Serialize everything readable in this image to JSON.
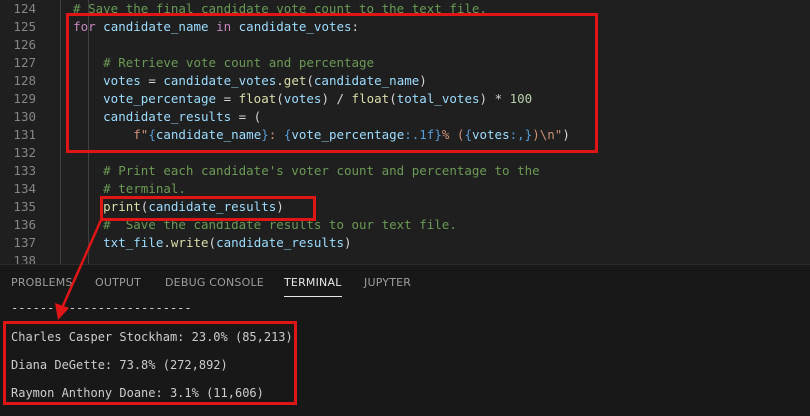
{
  "editor": {
    "lines": [
      {
        "n": "124",
        "segs": [
          {
            "t": "  # Save the final candidate vote count to the text file.",
            "c": "cm"
          }
        ]
      },
      {
        "n": "125",
        "segs": [
          {
            "t": "  ",
            "c": "op"
          },
          {
            "t": "for",
            "c": "kw"
          },
          {
            "t": " ",
            "c": "op"
          },
          {
            "t": "candidate_name",
            "c": "var"
          },
          {
            "t": " ",
            "c": "op"
          },
          {
            "t": "in",
            "c": "kw"
          },
          {
            "t": " ",
            "c": "op"
          },
          {
            "t": "candidate_votes",
            "c": "var"
          },
          {
            "t": ":",
            "c": "op"
          }
        ]
      },
      {
        "n": "126",
        "segs": [
          {
            "t": "",
            "c": "op"
          }
        ]
      },
      {
        "n": "127",
        "segs": [
          {
            "t": "      # Retrieve vote count and percentage",
            "c": "cm"
          }
        ]
      },
      {
        "n": "128",
        "segs": [
          {
            "t": "      ",
            "c": "op"
          },
          {
            "t": "votes",
            "c": "var"
          },
          {
            "t": " = ",
            "c": "op"
          },
          {
            "t": "candidate_votes",
            "c": "var"
          },
          {
            "t": ".",
            "c": "op"
          },
          {
            "t": "get",
            "c": "fn"
          },
          {
            "t": "(",
            "c": "op"
          },
          {
            "t": "candidate_name",
            "c": "var"
          },
          {
            "t": ")",
            "c": "op"
          }
        ]
      },
      {
        "n": "129",
        "segs": [
          {
            "t": "      ",
            "c": "op"
          },
          {
            "t": "vote_percentage",
            "c": "var"
          },
          {
            "t": " = ",
            "c": "op"
          },
          {
            "t": "float",
            "c": "fn"
          },
          {
            "t": "(",
            "c": "op"
          },
          {
            "t": "votes",
            "c": "var"
          },
          {
            "t": ") / ",
            "c": "op"
          },
          {
            "t": "float",
            "c": "fn"
          },
          {
            "t": "(",
            "c": "op"
          },
          {
            "t": "total_votes",
            "c": "var"
          },
          {
            "t": ") * ",
            "c": "op"
          },
          {
            "t": "100",
            "c": "num"
          }
        ]
      },
      {
        "n": "130",
        "segs": [
          {
            "t": "      ",
            "c": "op"
          },
          {
            "t": "candidate_results",
            "c": "var"
          },
          {
            "t": " = (",
            "c": "op"
          }
        ]
      },
      {
        "n": "131",
        "segs": [
          {
            "t": "          ",
            "c": "op"
          },
          {
            "t": "f\"",
            "c": "str"
          },
          {
            "t": "{",
            "c": "fmtk"
          },
          {
            "t": "candidate_name",
            "c": "var"
          },
          {
            "t": "}",
            "c": "fmtk"
          },
          {
            "t": ": ",
            "c": "str"
          },
          {
            "t": "{",
            "c": "fmtk"
          },
          {
            "t": "vote_percentage",
            "c": "var"
          },
          {
            "t": ":.1f}",
            "c": "fmtk"
          },
          {
            "t": "% (",
            "c": "str"
          },
          {
            "t": "{",
            "c": "fmtk"
          },
          {
            "t": "votes",
            "c": "var"
          },
          {
            "t": ":,}",
            "c": "fmtk"
          },
          {
            "t": ")\\n\"",
            "c": "str"
          },
          {
            "t": ")",
            "c": "op"
          }
        ]
      },
      {
        "n": "132",
        "segs": [
          {
            "t": "",
            "c": "op"
          }
        ]
      },
      {
        "n": "133",
        "segs": [
          {
            "t": "      # Print each candidate's voter count and percentage to the",
            "c": "cm"
          }
        ]
      },
      {
        "n": "134",
        "segs": [
          {
            "t": "      # terminal.",
            "c": "cm"
          }
        ]
      },
      {
        "n": "135",
        "segs": [
          {
            "t": "      ",
            "c": "op"
          },
          {
            "t": "print",
            "c": "fn"
          },
          {
            "t": "(",
            "c": "op"
          },
          {
            "t": "candidate_results",
            "c": "var"
          },
          {
            "t": ")",
            "c": "op"
          }
        ]
      },
      {
        "n": "136",
        "segs": [
          {
            "t": "      #  Save the candidate results to our text file.",
            "c": "cm"
          }
        ]
      },
      {
        "n": "137",
        "segs": [
          {
            "t": "      ",
            "c": "op"
          },
          {
            "t": "txt_file",
            "c": "var"
          },
          {
            "t": ".",
            "c": "op"
          },
          {
            "t": "write",
            "c": "fn"
          },
          {
            "t": "(",
            "c": "op"
          },
          {
            "t": "candidate_results",
            "c": "var"
          },
          {
            "t": ")",
            "c": "op"
          }
        ]
      },
      {
        "n": "138",
        "segs": [
          {
            "t": "",
            "c": "op"
          }
        ]
      }
    ]
  },
  "panel": {
    "tabs": [
      "PROBLEMS",
      "OUTPUT",
      "DEBUG CONSOLE",
      "TERMINAL",
      "JUPYTER"
    ],
    "active_tab": "TERMINAL",
    "terminal": {
      "separator": "-------------------------",
      "results": [
        "Charles Casper Stockham: 23.0% (85,213)",
        "Diana DeGette: 73.8% (272,892)",
        "Raymon Anthony Doane: 3.1% (11,606)"
      ]
    }
  },
  "annotation_color": "#e01515"
}
